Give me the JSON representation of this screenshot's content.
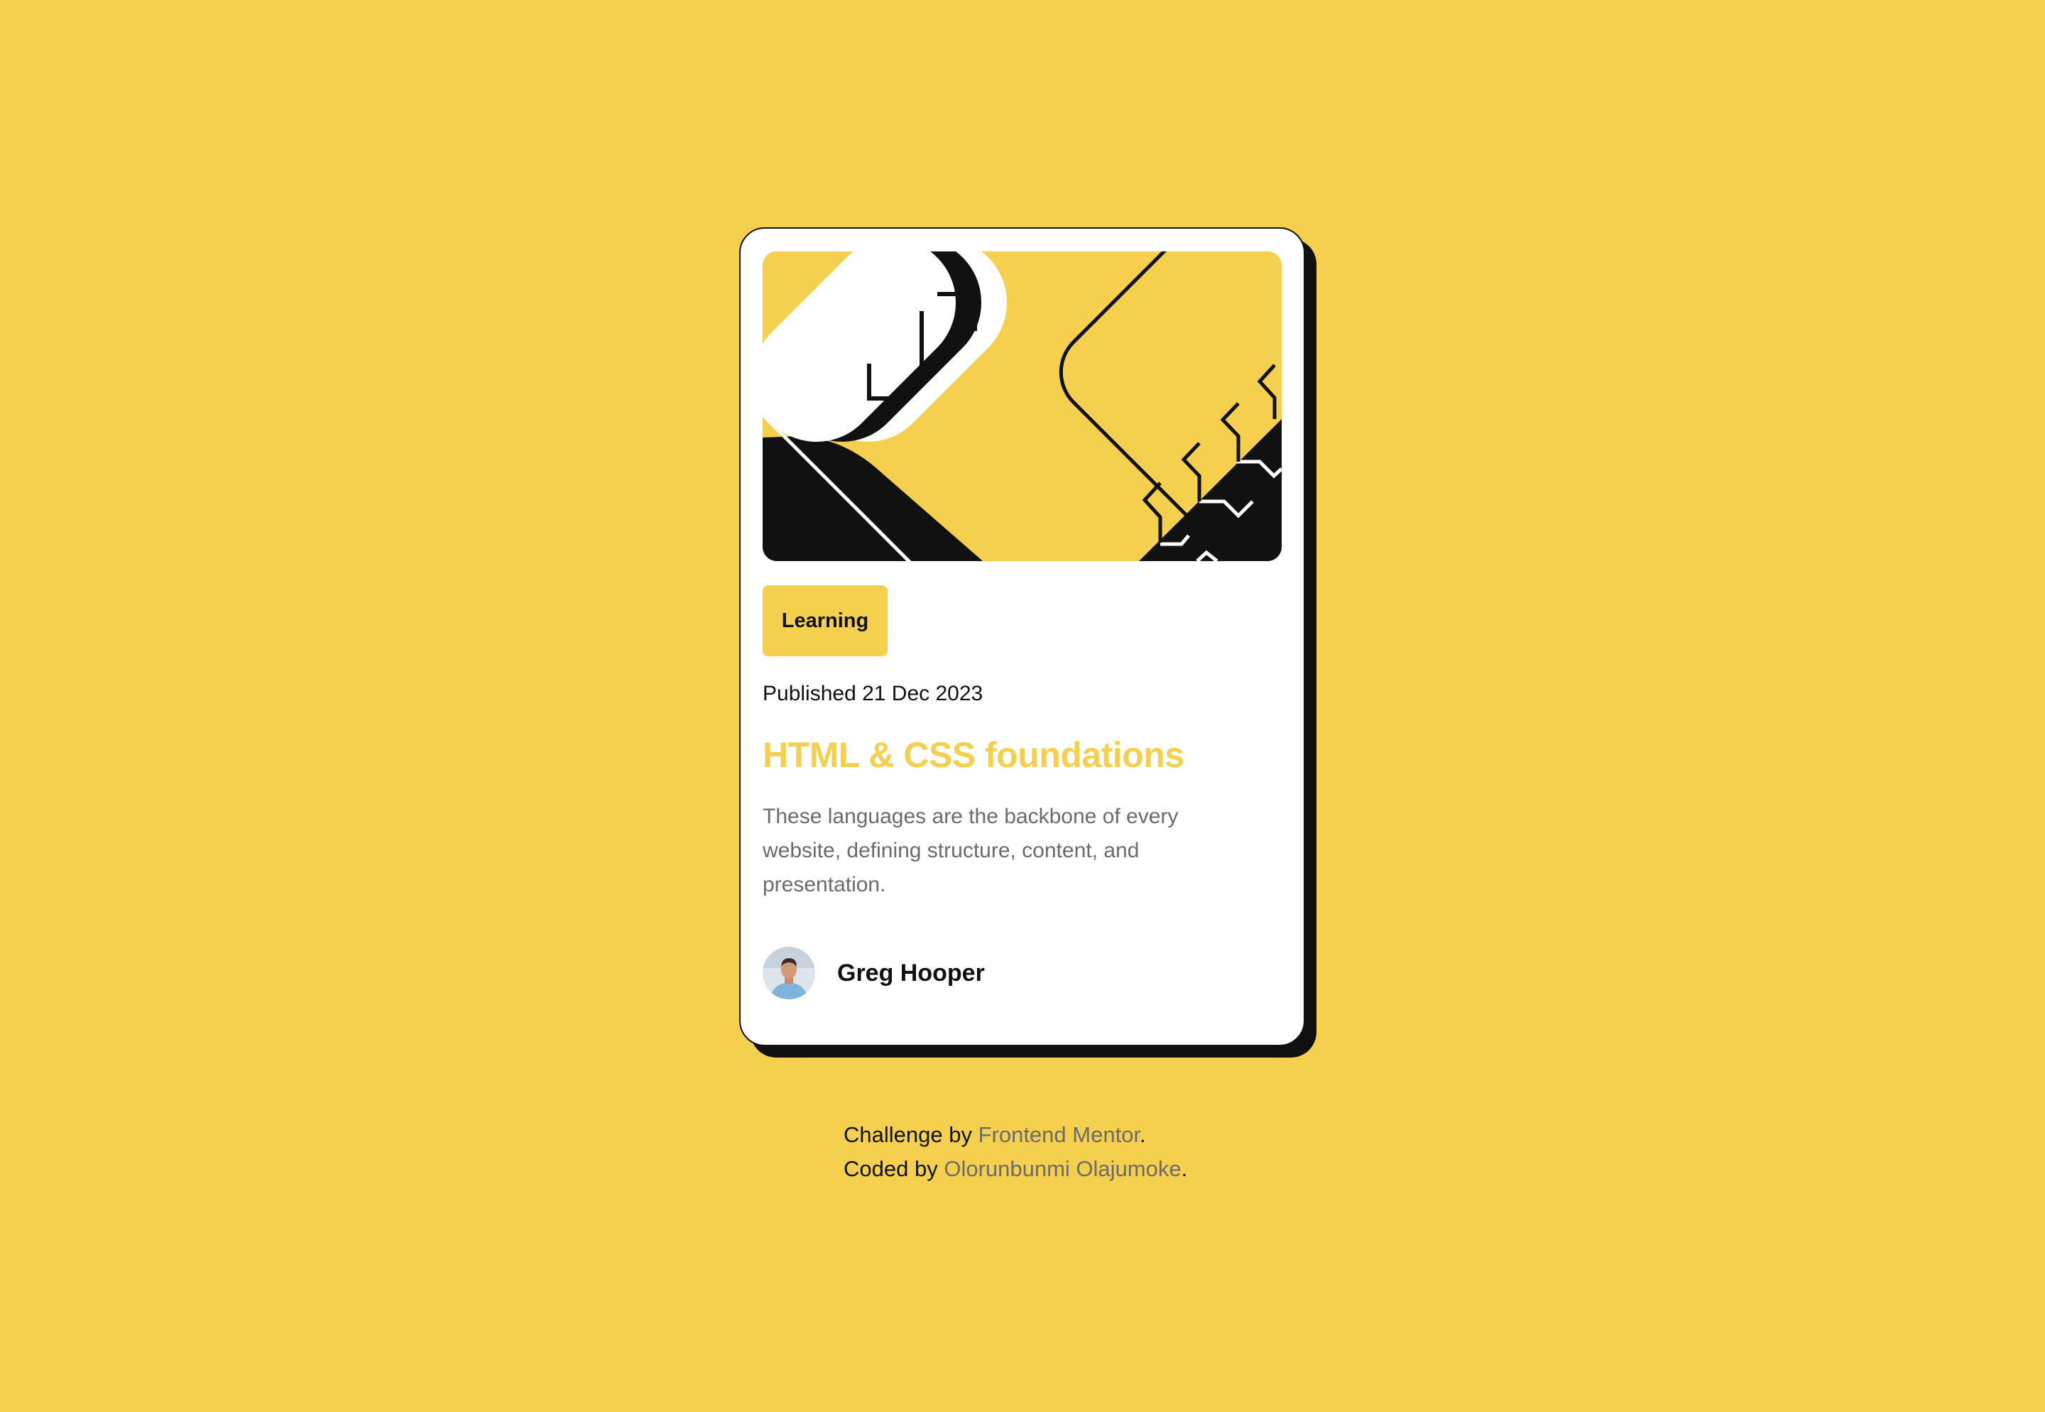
{
  "card": {
    "tag": "Learning",
    "published": "Published 21 Dec 2023",
    "title": "HTML & CSS foundations",
    "description": "These languages are the backbone of every website, defining structure, content, and presentation.",
    "author": {
      "name": "Greg Hooper",
      "avatar_icon": "avatar-photo"
    },
    "illustration_icon": "illustration-article"
  },
  "attribution": {
    "challenge_prefix": "Challenge by ",
    "challenge_link": "Frontend Mentor",
    "challenge_suffix": ".",
    "coded_prefix": "Coded by ",
    "coded_link": "Olorunbunmi Olajumoke",
    "coded_suffix": "."
  },
  "colors": {
    "background": "#F4D04E",
    "card": "#FFFFFF",
    "ink": "#111111",
    "muted": "#6B6B6B"
  }
}
